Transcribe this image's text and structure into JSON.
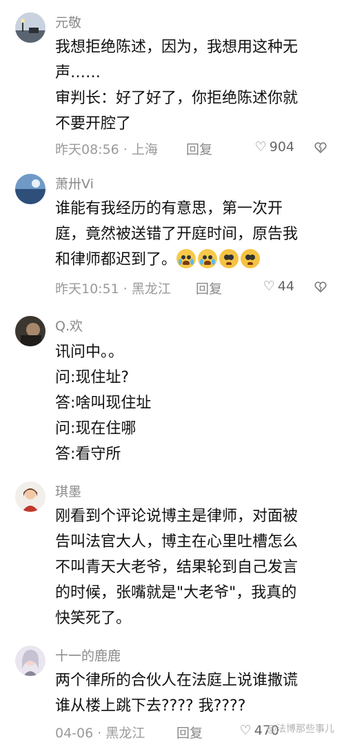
{
  "comments": [
    {
      "user": "元敬",
      "lines": [
        "我想拒绝陈述，因为，我想用这种无",
        "声……",
        "审判长：好了好了，你拒绝陈述你就",
        "不要开腔了"
      ],
      "time": "昨天08:56 · 上海",
      "reply": "回复",
      "likes": "904"
    },
    {
      "user": "萧卅Vi",
      "lines": [
        "谁能有我经历的有意思，第一次开",
        "庭，竟然被送错了开庭时间，原告我",
        "和律师都迟到了。"
      ],
      "emojis": [
        "crying-emoji",
        "crying-emoji",
        "pleading-emoji",
        "pleading-emoji"
      ],
      "time": "昨天10:51 · 黑龙江",
      "reply": "回复",
      "likes": "44"
    },
    {
      "user": "Q.欢",
      "lines": [
        "讯问中。。",
        "问:现住址?",
        "答:啥叫现住址",
        "问:现在住哪",
        "答:看守所"
      ]
    },
    {
      "user": "琪墨",
      "lines": [
        "刚看到个评论说博主是律师，对面被",
        "告叫法官大人，博主在心里吐槽怎么",
        "不叫青天大老爷，结果轮到自己发言",
        "的时候，张嘴就是\"大老爷\"，我真的",
        "快笑死了。"
      ]
    },
    {
      "user": "十一的鹿鹿",
      "lines": [
        "两个律所的合伙人在法庭上说谁撒谎",
        "谁从楼上跳下去???? 我????"
      ],
      "time": "04-06 · 黑龙江",
      "reply": "回复",
      "likes": "470"
    }
  ],
  "watermark": "@法博那些事儿",
  "icons": {
    "like": "heart-outline-icon",
    "dislike": "broken-heart-icon"
  }
}
